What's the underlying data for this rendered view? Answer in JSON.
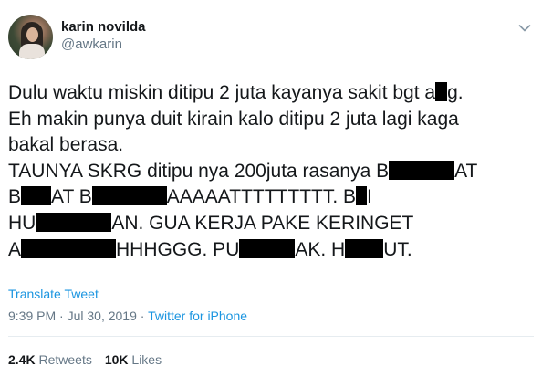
{
  "user": {
    "display_name": "karin novilda",
    "handle": "@awkarin"
  },
  "tweet": {
    "line1a": "Dulu waktu miskin ditipu 2 juta kayanya sakit bgt a",
    "line1b": "g.",
    "line2": "Eh makin punya duit kirain kalo ditipu 2 juta lagi kaga",
    "line3": "bakal berasa.",
    "line4a": "TAUNYA SKRG ditipu nya 200juta rasanya B",
    "line4b": "AT",
    "line5a": "B",
    "line5b": "AT B",
    "line5c": "AAAAATTTTTTTTT. B",
    "line5d": "I",
    "line6a": "HU",
    "line6b": "AN. GUA KERJA PAKE KERINGET",
    "line7a": "A",
    "line7b": "HHHGGG. PU",
    "line7c": "AK. H",
    "line7d": "UT."
  },
  "translate_label": "Translate Tweet",
  "meta": {
    "time": "9:39 PM",
    "separator": " · ",
    "date": "Jul 30, 2019",
    "source": "Twitter for iPhone"
  },
  "stats": {
    "retweets_count": "2.4K",
    "retweets_label": "Retweets",
    "likes_count": "10K",
    "likes_label": "Likes"
  },
  "icons": {
    "caret": "chevron-down-icon"
  },
  "colors": {
    "link": "#1b95e0",
    "secondary": "#657786",
    "text": "#14171a",
    "redaction": "#000000"
  }
}
